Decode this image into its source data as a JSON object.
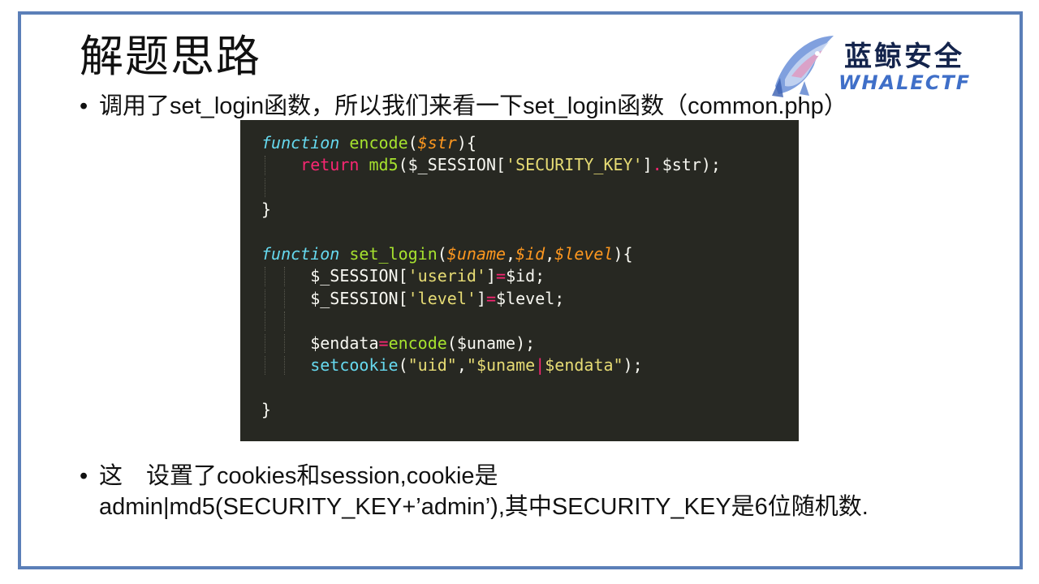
{
  "slide": {
    "title": "解题思路",
    "bullet1": "调用了set_login函数，所以我们来看一下set_login函数（common.php）",
    "bullet2_line1": "这　设置了cookies和session,cookie是",
    "bullet2_line2": "admin|md5(SECURITY_KEY+’admin’),其中SECURITY_KEY是6位随机数.",
    "bullet_char": "•"
  },
  "logo": {
    "cn_text": "蓝鲸安全",
    "en_text": "WHALECTF",
    "icon": "whale-logo-icon"
  },
  "code": {
    "l1_kw": "function",
    "l1_name": "encode",
    "l1_open": "(",
    "l1_param": "$str",
    "l1_close": "){",
    "l2_kw": "return",
    "l2_fn": "md5",
    "l2_a": "($_SESSION[",
    "l2_str": "'SECURITY_KEY'",
    "l2_b": "]",
    "l2_op": ".",
    "l2_c": "$str);",
    "l4": "}",
    "l6_kw": "function",
    "l6_name": "set_login",
    "l6_open": "(",
    "l6_p1": "$uname",
    "l6_c1": ",",
    "l6_p2": "$id",
    "l6_c2": ",",
    "l6_p3": "$level",
    "l6_close": "){",
    "l7_a": "$_SESSION[",
    "l7_str": "'userid'",
    "l7_b": "]",
    "l7_op": "=",
    "l7_c": "$id;",
    "l8_a": "$_SESSION[",
    "l8_str": "'level'",
    "l8_b": "]",
    "l8_op": "=",
    "l8_c": "$level;",
    "l10_a": "$endata",
    "l10_op": "=",
    "l10_fn": "encode",
    "l10_c": "($uname);",
    "l11_fn": "setcookie",
    "l11_a": "(",
    "l11_s1": "\"uid\"",
    "l11_b": ",",
    "l11_s2a": "\"$uname",
    "l11_pipe": "|",
    "l11_s2b": "$endata\"",
    "l11_c": ");",
    "l13": "}"
  },
  "colors": {
    "frame_border": "#5b7fb8",
    "code_bg": "#272822",
    "keyword_fn": "#66d9ef",
    "function_name": "#a6e22e",
    "parameter": "#fd971f",
    "keyword": "#f92672",
    "string": "#e6db74"
  }
}
